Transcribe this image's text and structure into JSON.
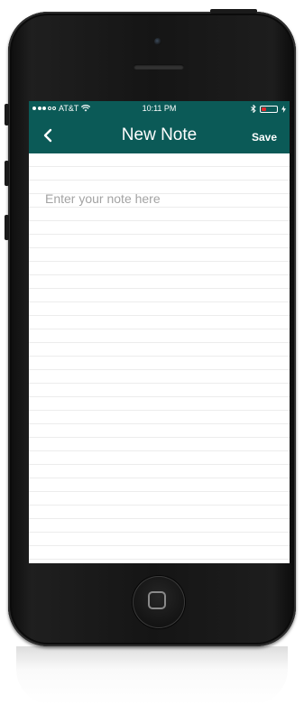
{
  "status_bar": {
    "carrier": "AT&T",
    "time": "10:11 PM",
    "battery_color": "#e0292b"
  },
  "nav_bar": {
    "title": "New Note",
    "back_icon": "chevron-left-icon",
    "save_label": "Save",
    "background_color": "#0b5a57"
  },
  "note": {
    "placeholder": "Enter your note here",
    "value": ""
  }
}
